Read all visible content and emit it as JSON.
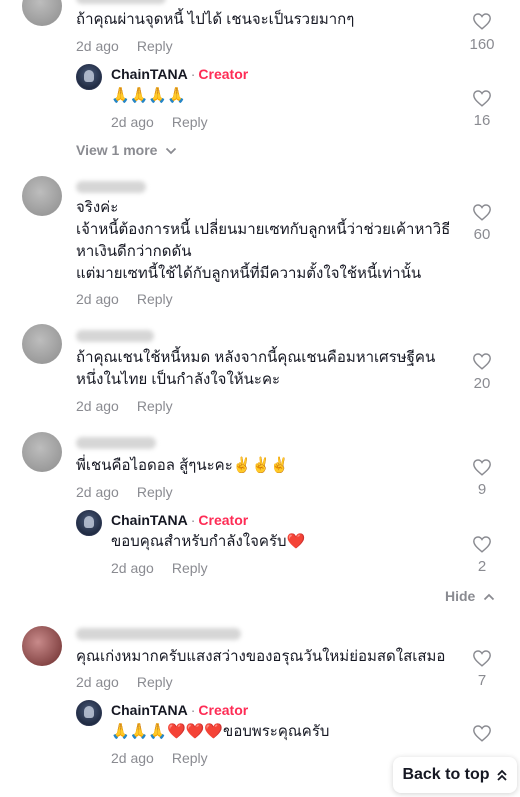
{
  "comments": [
    {
      "text": "ถ้าคุณผ่านจุดหนี้ ไปได้ เชนจะเป็นรวยมากๆ",
      "date": "2d ago",
      "reply": "Reply",
      "likes": "160",
      "replies": [
        {
          "name": "ChainTANA",
          "role": "Creator",
          "text": "🙏🙏🙏🙏",
          "date": "2d ago",
          "reply": "Reply",
          "likes": "16"
        }
      ],
      "toggle": "View 1 more"
    },
    {
      "text_lines": [
        "จริงค่ะ",
        "เจ้าหนี้ต้องการหนี้ เปลี่ยนมายเซทกับลูกหนี้ว่าช่วยเค้าหาวิธี",
        "หาเงินดีกว่ากดดัน",
        "แต่มายเซทนี้ใช้ได้กับลูกหนี้ที่มีความตั้งใจใช้หนี้เท่านั้น"
      ],
      "date": "2d ago",
      "reply": "Reply",
      "likes": "60"
    },
    {
      "text_lines": [
        "ถ้าคุณเชนใช้หนี้หมด หลังจากนี้คุณเชนคือมหาเศรษฐีคน",
        "หนึ่งในไทย เป็นกำลังใจให้นะคะ"
      ],
      "date": "2d ago",
      "reply": "Reply",
      "likes": "20"
    },
    {
      "text": "พี่เชนคือไอดอล สู้ๆนะคะ✌️✌️✌️",
      "date": "2d ago",
      "reply": "Reply",
      "likes": "9",
      "replies": [
        {
          "name": "ChainTANA",
          "role": "Creator",
          "text": "ขอบคุณสำหรับกำลังใจครับ❤️",
          "date": "2d ago",
          "reply": "Reply",
          "likes": "2"
        }
      ],
      "toggle": "Hide"
    },
    {
      "text": "คุณเก่งหมากครับแสงสว่างของอรุณวันใหม่ย่อมสดใสเสมอ",
      "date": "2d ago",
      "reply": "Reply",
      "likes": "7",
      "replies": [
        {
          "name": "ChainTANA",
          "role": "Creator",
          "text": "🙏🙏🙏❤️❤️❤️ขอบพระคุณครับ",
          "date": "2d ago",
          "reply": "Reply",
          "likes": ""
        }
      ]
    }
  ],
  "back_to_top": "Back to top",
  "colors": {
    "creator": "#fe2c55",
    "muted": "#8a8b91",
    "text": "#161823"
  }
}
